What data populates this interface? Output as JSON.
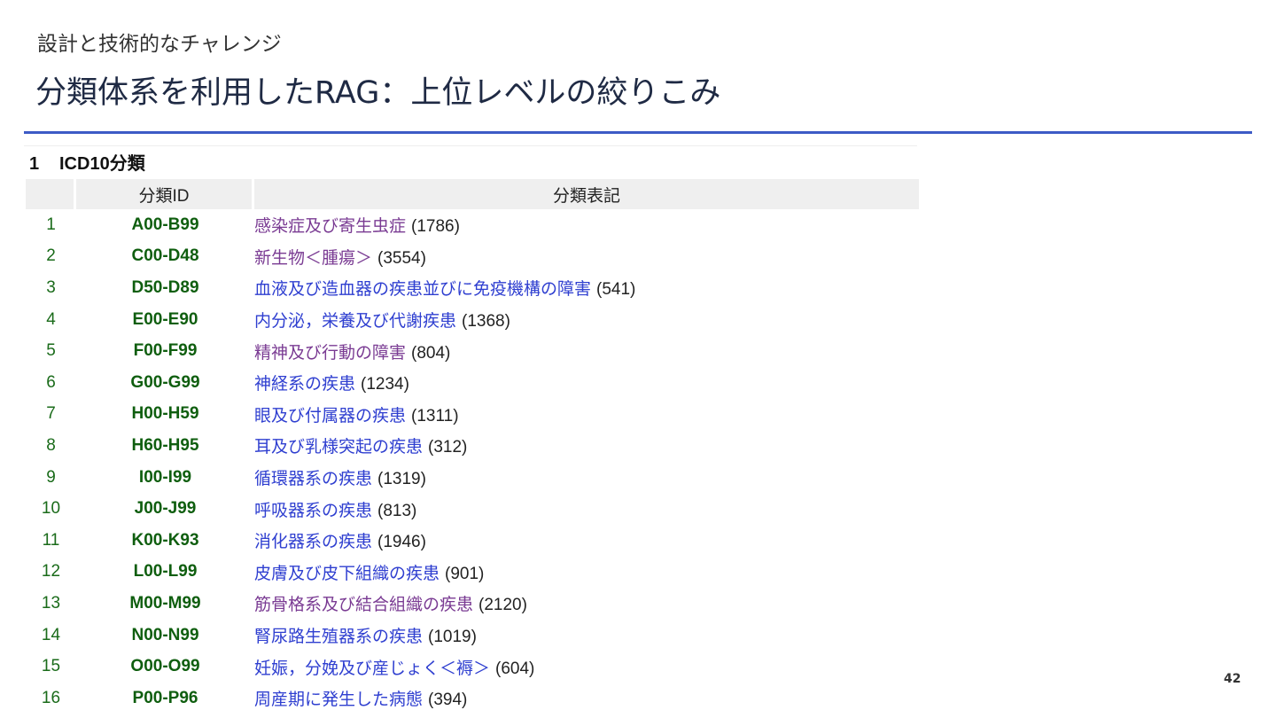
{
  "slide": {
    "section": "設計と技術的なチャレンジ",
    "title": "分類体系を利用したRAG：上位レベルの絞りこみ",
    "page_number": "42"
  },
  "table": {
    "caption_number": "1",
    "caption_title": "ICD10分類",
    "headers": {
      "number": "",
      "id": "分類ID",
      "label": "分類表記"
    },
    "rows": [
      {
        "no": "1",
        "id": "A00-B99",
        "label": "感染症及び寄生虫症",
        "count": "(1786)"
      },
      {
        "no": "2",
        "id": "C00-D48",
        "label": "新生物＜腫瘍＞",
        "count": "(3554)"
      },
      {
        "no": "3",
        "id": "D50-D89",
        "label": "血液及び造血器の疾患並びに免疫機構の障害",
        "count": "(541)"
      },
      {
        "no": "4",
        "id": "E00-E90",
        "label": "内分泌，栄養及び代謝疾患",
        "count": "(1368)"
      },
      {
        "no": "5",
        "id": "F00-F99",
        "label": "精神及び行動の障害",
        "count": "(804)"
      },
      {
        "no": "6",
        "id": "G00-G99",
        "label": "神経系の疾患",
        "count": "(1234)"
      },
      {
        "no": "7",
        "id": "H00-H59",
        "label": "眼及び付属器の疾患",
        "count": "(1311)"
      },
      {
        "no": "8",
        "id": "H60-H95",
        "label": "耳及び乳様突起の疾患",
        "count": "(312)"
      },
      {
        "no": "9",
        "id": "I00-I99",
        "label": "循環器系の疾患",
        "count": "(1319)"
      },
      {
        "no": "10",
        "id": "J00-J99",
        "label": "呼吸器系の疾患",
        "count": "(813)"
      },
      {
        "no": "11",
        "id": "K00-K93",
        "label": "消化器系の疾患",
        "count": "(1946)"
      },
      {
        "no": "12",
        "id": "L00-L99",
        "label": "皮膚及び皮下組織の疾患",
        "count": "(901)"
      },
      {
        "no": "13",
        "id": "M00-M99",
        "label": "筋骨格系及び結合組織の疾患",
        "count": "(2120)"
      },
      {
        "no": "14",
        "id": "N00-N99",
        "label": "腎尿路生殖器系の疾患",
        "count": "(1019)"
      },
      {
        "no": "15",
        "id": "O00-O99",
        "label": "妊娠，分娩及び産じょく＜褥＞",
        "count": "(604)"
      },
      {
        "no": "16",
        "id": "P00-P96",
        "label": "周産期に発生した病態",
        "count": "(394)"
      }
    ]
  },
  "colors": {
    "title_rule": "#3d5bc6",
    "link": "#2f3fd0",
    "visited_link": "#7a3b93",
    "id_green": "#0f5e0f",
    "number_green": "#1a6b1a"
  }
}
